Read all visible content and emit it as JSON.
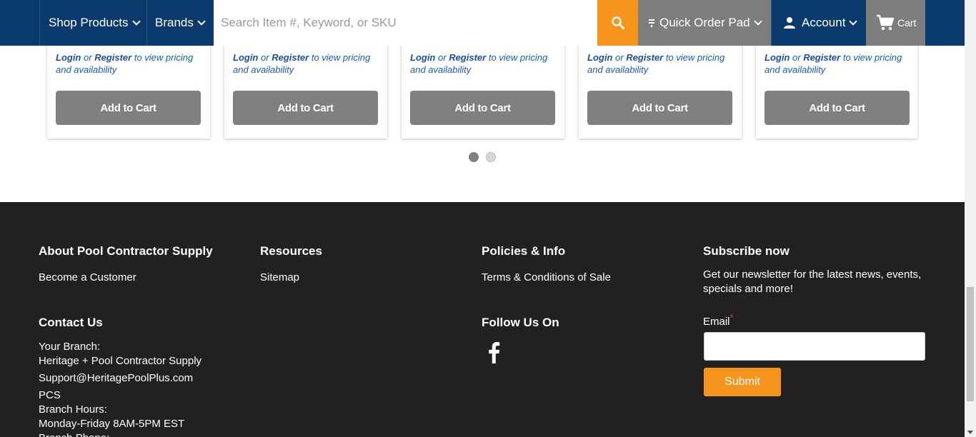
{
  "header": {
    "shop_products": "Shop Products",
    "brands": "Brands",
    "search_placeholder": "Search Item #, Keyword, or SKU",
    "quick_order_pad": "Quick Order Pad",
    "account": "Account",
    "cart": "Cart"
  },
  "cards": [
    {
      "login": "Login",
      "or": " or ",
      "register": "Register",
      "suffix": " to view pricing and availability",
      "button": "Add to Cart"
    },
    {
      "login": "Login",
      "or": " or ",
      "register": "Register",
      "suffix": " to view pricing and availability",
      "button": "Add to Cart"
    },
    {
      "login": "Login",
      "or": " or ",
      "register": "Register",
      "suffix": " to view pricing and availability",
      "button": "Add to Cart"
    },
    {
      "login": "Login",
      "or": " or ",
      "register": "Register",
      "suffix": " to view pricing and availability",
      "button": "Add to Cart"
    },
    {
      "login": "Login",
      "or": " or ",
      "register": "Register",
      "suffix": " to view pricing and availability",
      "button": "Add to Cart"
    }
  ],
  "carousel": {
    "pages": 2,
    "active": 1
  },
  "footer": {
    "about": {
      "title": "About Pool Contractor Supply",
      "links": [
        "Become a Customer"
      ]
    },
    "resources": {
      "title": "Resources",
      "links": [
        "Sitemap"
      ]
    },
    "policies": {
      "title": "Policies & Info",
      "links": [
        "Terms & Conditions of Sale"
      ]
    },
    "subscribe": {
      "title": "Subscribe now",
      "text": "Get our newsletter for the latest news, events, specials and more!",
      "email_label": "Email",
      "required_mark": "*",
      "submit": "Submit"
    },
    "contact": {
      "title": "Contact Us",
      "branch_label": "Your Branch:",
      "branch_name": "Heritage + Pool Contractor Supply",
      "email": "Support@HeritagePoolPlus.com",
      "code": "PCS",
      "hours_label": "Branch Hours:",
      "hours": "Monday-Friday 8AM-5PM EST",
      "phone_label": "Branch Phone:"
    },
    "follow": {
      "title": "Follow Us On",
      "icons": [
        "facebook-icon"
      ]
    }
  },
  "colors": {
    "navy": "#0a3a6b",
    "orange": "#f7941d",
    "gray": "#808080",
    "footer": "#222121",
    "link": "#1c5ba8"
  }
}
